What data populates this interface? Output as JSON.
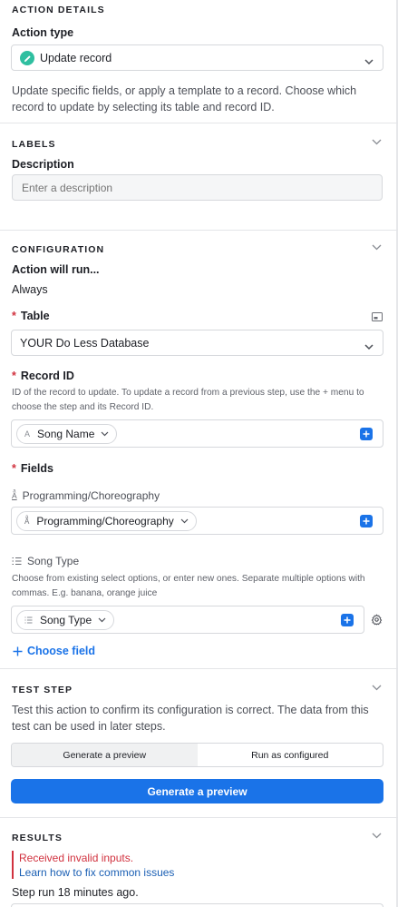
{
  "action_details": {
    "heading": "ACTION DETAILS",
    "action_type_label": "Action type",
    "action_type_value": "Update record",
    "description": "Update specific fields, or apply a template to a record. Choose which record to update by selecting its table and record ID."
  },
  "labels": {
    "heading": "LABELS",
    "description_label": "Description",
    "description_placeholder": "Enter a description"
  },
  "configuration": {
    "heading": "CONFIGURATION",
    "action_will_run_label": "Action will run...",
    "action_will_run_value": "Always",
    "required_mark": "*",
    "table_label": "Table",
    "table_value": "YOUR Do Less Database",
    "record_id_label": "Record ID",
    "record_id_help": "ID of the record to update. To update a record from a previous step, use the + menu to choose the step and its Record ID.",
    "record_id_token": "Song Name",
    "fields_label": "Fields",
    "fields": [
      {
        "title": "Programming/Choreography",
        "token": "Programming/Choreography",
        "help": ""
      },
      {
        "title": "Song Type",
        "token": "Song Type",
        "help": "Choose from existing select options, or enter new ones. Separate multiple options with commas. E.g. banana, orange juice"
      }
    ],
    "choose_field_label": "Choose field"
  },
  "test_step": {
    "heading": "TEST STEP",
    "description": "Test this action to confirm its configuration is correct. The data from this test can be used in later steps.",
    "tabs": [
      "Generate a preview",
      "Run as configured"
    ],
    "active_tab": "Generate a preview",
    "primary_button": "Generate a preview"
  },
  "results": {
    "heading": "RESULTS",
    "error_title": "Received invalid inputs.",
    "error_link": "Learn how to fix common issues",
    "step_run_text": "Step run 18 minutes ago."
  },
  "colors": {
    "accent_blue": "#1a73e8",
    "error_red": "#d1323f",
    "icon_teal": "#2fbfa0"
  }
}
